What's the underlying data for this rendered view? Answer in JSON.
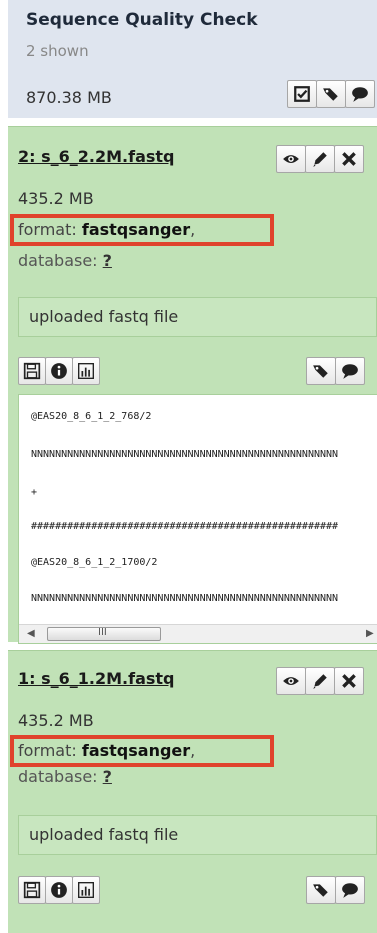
{
  "history": {
    "title": "Sequence Quality Check",
    "shown": "2 shown",
    "size": "870.38 MB",
    "icons": [
      "checkbox-icon",
      "tags-icon",
      "comment-icon"
    ]
  },
  "datasets": [
    {
      "title": "2: s_6_2.2M.fastq",
      "size": "435.2 MB",
      "format_label": "format:",
      "format_value": "fastqsanger",
      "format_suffix": ",",
      "database_label": "database:",
      "database_value": "?",
      "info": "uploaded fastq file",
      "icons": [
        "eye-icon",
        "pencil-icon",
        "delete-icon"
      ],
      "actions_left": [
        "save-icon",
        "info-icon",
        "chart-icon"
      ],
      "actions_right": [
        "tags-icon",
        "comment-icon"
      ],
      "peek": [
        "@EAS20_8_6_1_2_768/2",
        "NNNNNNNNNNNNNNNNNNNNNNNNNNNNNNNNNNNNNNNNNNNNNNNNNNN",
        "+",
        "###################################################",
        "@EAS20_8_6_1_2_1700/2",
        "NNNNNNNNNNNNNNNNNNNNNNNNNNNNNNNNNNNNNNNNNNNNNNNNNNN"
      ],
      "scrollbar": {
        "left": "◀",
        "thumb": "III",
        "right": "▶"
      }
    },
    {
      "title": "1: s_6_1.2M.fastq",
      "size": "435.2 MB",
      "format_label": "format:",
      "format_value": "fastqsanger",
      "format_suffix": ",",
      "database_label": "database:",
      "database_value": "?",
      "info": "uploaded fastq file",
      "icons": [
        "eye-icon",
        "pencil-icon",
        "delete-icon"
      ],
      "actions_left": [
        "save-icon",
        "info-icon",
        "chart-icon"
      ],
      "actions_right": [
        "tags-icon",
        "comment-icon"
      ]
    }
  ],
  "colors": {
    "header_bg": "#dfe5ef",
    "dataset_ok_bg": "#c1e2b7",
    "highlight": "#e0432c"
  }
}
